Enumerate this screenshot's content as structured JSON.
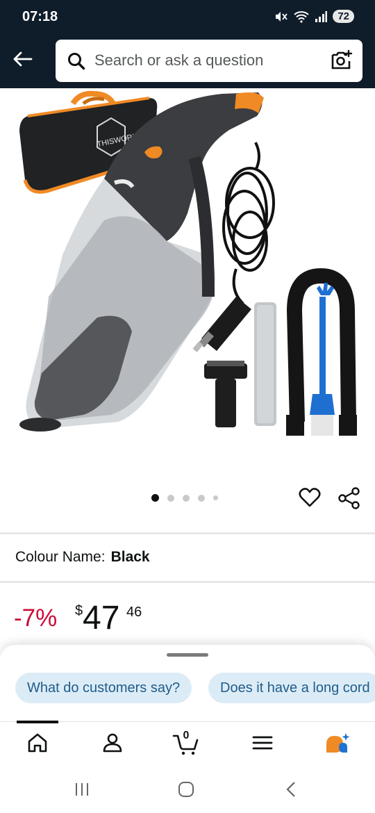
{
  "status_bar": {
    "time": "07:18",
    "battery": "72",
    "icons": [
      "mute-icon",
      "wifi-icon",
      "signal-icon"
    ]
  },
  "header": {
    "back_icon": "arrow-left-icon",
    "search": {
      "placeholder": "Search or ask a question",
      "value": "",
      "camera_icon": "camera-lens-icon"
    }
  },
  "product": {
    "image_alt": "THISWORX handheld car vacuum with carry bag, cord and attachments",
    "brand_logo_text": "THISWORX",
    "carousel": {
      "total_dots": 5,
      "active_index": 0
    },
    "colour": {
      "label": "Colour Name:",
      "value": "Black"
    },
    "price": {
      "discount": "-7%",
      "currency": "$",
      "whole": "47",
      "fraction": "46"
    }
  },
  "suggestions": {
    "chips": [
      "What do customers say?",
      "Does it have a long cord"
    ]
  },
  "bottom_nav": {
    "items": [
      "home-icon",
      "account-icon",
      "cart-icon",
      "menu-icon",
      "rufus-icon"
    ],
    "cart_count": "0",
    "active_index": 0
  },
  "colors": {
    "header_bg": "#0f1c2a",
    "discount_red": "#cc0c39",
    "chip_bg": "#dcecf7",
    "chip_text": "#1f5c8a",
    "accent_orange": "#f08a24",
    "accent_blue": "#1f73d1"
  }
}
